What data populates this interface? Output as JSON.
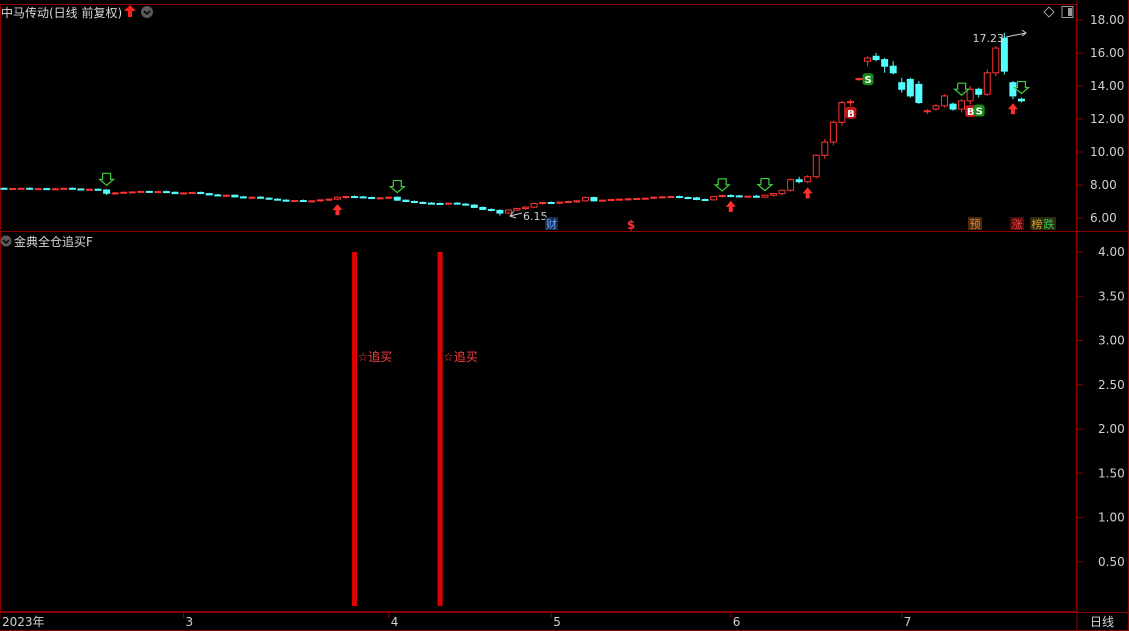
{
  "main_panel": {
    "title": "中马传动(日线 前复权)",
    "y_ticks": [
      "18.00",
      "16.00",
      "14.00",
      "12.00",
      "10.00",
      "8.00",
      "6.00"
    ],
    "high_label": "17.23",
    "low_label": "6.15",
    "badges": [
      {
        "text": "财",
        "color": "#6aa8ff"
      },
      {
        "text": "$",
        "color": "#ff3030"
      },
      {
        "text": "预",
        "color": "#e08030"
      },
      {
        "text": "涨",
        "color": "#ff4040"
      },
      {
        "text": "榜",
        "color": "#e0a020"
      },
      {
        "text": "跌",
        "color": "#30d050"
      }
    ]
  },
  "indicator_panel": {
    "title": "金典全仓追买F",
    "y_ticks": [
      "4.00",
      "3.50",
      "3.00",
      "2.50",
      "2.00",
      "1.50",
      "1.00",
      "0.50"
    ],
    "signal_label": "☆追买"
  },
  "x_axis": {
    "labels": [
      "2023年",
      "3",
      "4",
      "5",
      "6",
      "7"
    ],
    "period": "日线"
  },
  "colors": {
    "up": "#ff3232",
    "down": "#54ffff",
    "buy": "#ff3030",
    "sell": "#30c030",
    "grid": "#8b0000"
  },
  "chart_data": [
    {
      "type": "candlestick",
      "title": "中马传动(日线 前复权)",
      "ylim": [
        5.5,
        18.6
      ],
      "y_ticks": [
        18,
        16,
        14,
        12,
        10,
        8,
        6
      ],
      "x_ticks": [
        "2023年",
        "3",
        "4",
        "5",
        "6",
        "7"
      ],
      "annotations": [
        {
          "text": "17.23",
          "value": 17.23
        },
        {
          "text": "6.15",
          "value": 6.15
        }
      ],
      "ohlc": [
        [
          7.8,
          7.85,
          7.72,
          7.76
        ],
        [
          7.76,
          7.82,
          7.7,
          7.79
        ],
        [
          7.79,
          7.84,
          7.74,
          7.8
        ],
        [
          7.8,
          7.86,
          7.71,
          7.74
        ],
        [
          7.74,
          7.8,
          7.7,
          7.78
        ],
        [
          7.78,
          7.83,
          7.72,
          7.75
        ],
        [
          7.75,
          7.81,
          7.7,
          7.77
        ],
        [
          7.77,
          7.82,
          7.73,
          7.8
        ],
        [
          7.8,
          7.85,
          7.74,
          7.76
        ],
        [
          7.76,
          7.8,
          7.7,
          7.73
        ],
        [
          7.73,
          7.78,
          7.68,
          7.74
        ],
        [
          7.74,
          7.79,
          7.68,
          7.7
        ],
        [
          7.7,
          7.74,
          7.4,
          7.5
        ],
        [
          7.5,
          7.58,
          7.42,
          7.52
        ],
        [
          7.52,
          7.6,
          7.46,
          7.56
        ],
        [
          7.56,
          7.62,
          7.5,
          7.58
        ],
        [
          7.58,
          7.64,
          7.52,
          7.61
        ],
        [
          7.61,
          7.66,
          7.55,
          7.58
        ],
        [
          7.58,
          7.64,
          7.52,
          7.6
        ],
        [
          7.6,
          7.66,
          7.54,
          7.56
        ],
        [
          7.56,
          7.6,
          7.45,
          7.48
        ],
        [
          7.48,
          7.56,
          7.42,
          7.52
        ],
        [
          7.52,
          7.58,
          7.46,
          7.55
        ],
        [
          7.55,
          7.6,
          7.45,
          7.48
        ],
        [
          7.48,
          7.52,
          7.38,
          7.4
        ],
        [
          7.4,
          7.46,
          7.32,
          7.36
        ],
        [
          7.36,
          7.42,
          7.28,
          7.38
        ],
        [
          7.38,
          7.42,
          7.25,
          7.28
        ],
        [
          7.28,
          7.34,
          7.18,
          7.22
        ],
        [
          7.22,
          7.3,
          7.16,
          7.26
        ],
        [
          7.26,
          7.32,
          7.16,
          7.2
        ],
        [
          7.2,
          7.26,
          7.1,
          7.14
        ],
        [
          7.14,
          7.2,
          7.06,
          7.08
        ],
        [
          7.08,
          7.14,
          7.0,
          7.04
        ],
        [
          7.04,
          7.1,
          6.98,
          7.06
        ],
        [
          7.06,
          7.12,
          7.0,
          7.02
        ],
        [
          7.02,
          7.08,
          6.96,
          7.04
        ],
        [
          7.04,
          7.12,
          6.98,
          7.1
        ],
        [
          7.1,
          7.18,
          7.04,
          7.14
        ],
        [
          7.14,
          7.3,
          7.08,
          7.26
        ],
        [
          7.26,
          7.34,
          7.18,
          7.3
        ],
        [
          7.3,
          7.36,
          7.22,
          7.28
        ],
        [
          7.28,
          7.34,
          7.2,
          7.24
        ],
        [
          7.24,
          7.3,
          7.16,
          7.2
        ],
        [
          7.2,
          7.26,
          7.14,
          7.22
        ],
        [
          7.22,
          7.3,
          7.16,
          7.26
        ],
        [
          7.26,
          7.3,
          7.04,
          7.08
        ],
        [
          7.08,
          7.12,
          6.96,
          7.0
        ],
        [
          7.0,
          7.06,
          6.9,
          6.94
        ],
        [
          6.94,
          7.0,
          6.86,
          6.9
        ],
        [
          6.9,
          6.96,
          6.82,
          6.88
        ],
        [
          6.88,
          6.94,
          6.8,
          6.86
        ],
        [
          6.86,
          6.92,
          6.8,
          6.9
        ],
        [
          6.9,
          6.96,
          6.82,
          6.84
        ],
        [
          6.84,
          6.9,
          6.76,
          6.78
        ],
        [
          6.78,
          6.84,
          6.6,
          6.64
        ],
        [
          6.64,
          6.7,
          6.48,
          6.52
        ],
        [
          6.52,
          6.58,
          6.4,
          6.46
        ],
        [
          6.46,
          6.52,
          6.15,
          6.3
        ],
        [
          6.3,
          6.52,
          6.25,
          6.48
        ],
        [
          6.48,
          6.62,
          6.42,
          6.58
        ],
        [
          6.58,
          6.72,
          6.5,
          6.66
        ],
        [
          6.66,
          6.92,
          6.6,
          6.88
        ],
        [
          6.88,
          6.98,
          6.8,
          6.94
        ],
        [
          6.94,
          7.0,
          6.86,
          6.92
        ],
        [
          6.92,
          6.98,
          6.84,
          6.96
        ],
        [
          6.96,
          7.04,
          6.9,
          7.0
        ],
        [
          7.0,
          7.08,
          6.92,
          7.04
        ],
        [
          7.04,
          7.3,
          6.98,
          7.24
        ],
        [
          7.24,
          7.3,
          7.0,
          7.04
        ],
        [
          7.04,
          7.12,
          6.98,
          7.08
        ],
        [
          7.08,
          7.16,
          7.02,
          7.12
        ],
        [
          7.12,
          7.18,
          7.06,
          7.14
        ],
        [
          7.14,
          7.2,
          7.08,
          7.16
        ],
        [
          7.16,
          7.22,
          7.1,
          7.18
        ],
        [
          7.18,
          7.24,
          7.12,
          7.2
        ],
        [
          7.2,
          7.3,
          7.14,
          7.26
        ],
        [
          7.26,
          7.32,
          7.2,
          7.28
        ],
        [
          7.28,
          7.34,
          7.22,
          7.3
        ],
        [
          7.3,
          7.36,
          7.2,
          7.24
        ],
        [
          7.24,
          7.3,
          7.18,
          7.22
        ],
        [
          7.22,
          7.28,
          7.08,
          7.12
        ],
        [
          7.12,
          7.18,
          7.06,
          7.1
        ],
        [
          7.1,
          7.34,
          7.06,
          7.3
        ],
        [
          7.3,
          7.4,
          7.24,
          7.36
        ],
        [
          7.36,
          7.44,
          7.28,
          7.34
        ],
        [
          7.34,
          7.4,
          7.26,
          7.3
        ],
        [
          7.3,
          7.36,
          7.24,
          7.32
        ],
        [
          7.32,
          7.4,
          7.22,
          7.26
        ],
        [
          7.26,
          7.42,
          7.2,
          7.38
        ],
        [
          7.38,
          7.52,
          7.3,
          7.48
        ],
        [
          7.48,
          7.72,
          7.4,
          7.68
        ],
        [
          7.68,
          8.4,
          7.6,
          8.32
        ],
        [
          8.32,
          8.5,
          8.1,
          8.2
        ],
        [
          8.2,
          8.6,
          8.1,
          8.5
        ],
        [
          8.5,
          9.85,
          8.4,
          9.8
        ],
        [
          9.8,
          10.8,
          9.6,
          10.6
        ],
        [
          10.6,
          11.9,
          10.4,
          11.8
        ],
        [
          11.8,
          13.1,
          11.6,
          13.0
        ],
        [
          13.0,
          13.2,
          12.8,
          13.05
        ],
        [
          14.4,
          14.5,
          14.3,
          14.45
        ],
        [
          15.5,
          15.8,
          15.2,
          15.7
        ],
        [
          15.8,
          16.0,
          15.5,
          15.6
        ],
        [
          15.6,
          15.7,
          14.8,
          15.2
        ],
        [
          15.2,
          15.5,
          14.7,
          14.8
        ],
        [
          14.2,
          14.5,
          13.6,
          13.8
        ],
        [
          14.4,
          14.5,
          13.3,
          13.4
        ],
        [
          14.1,
          14.3,
          12.9,
          13.0
        ],
        [
          12.5,
          12.6,
          12.3,
          12.5
        ],
        [
          12.6,
          12.9,
          12.5,
          12.8
        ],
        [
          12.8,
          13.5,
          12.7,
          13.4
        ],
        [
          12.9,
          13.0,
          12.5,
          12.6
        ],
        [
          12.6,
          13.2,
          12.4,
          13.1
        ],
        [
          13.1,
          14.0,
          12.9,
          13.8
        ],
        [
          13.8,
          13.9,
          13.3,
          13.5
        ],
        [
          13.5,
          15.0,
          13.4,
          14.8
        ],
        [
          14.8,
          16.4,
          14.6,
          16.3
        ],
        [
          16.9,
          17.23,
          14.7,
          14.9
        ],
        [
          14.2,
          14.3,
          13.2,
          13.4
        ],
        [
          13.2,
          13.3,
          13.0,
          13.1
        ]
      ],
      "signals": [
        {
          "bar": 12,
          "kind": "sell-arrow"
        },
        {
          "bar": 39,
          "kind": "buy-arrow"
        },
        {
          "bar": 46,
          "kind": "sell-arrow"
        },
        {
          "bar": 84,
          "kind": "sell-arrow"
        },
        {
          "bar": 85,
          "kind": "buy-arrow"
        },
        {
          "bar": 89,
          "kind": "sell-arrow"
        },
        {
          "bar": 94,
          "kind": "buy-arrow"
        },
        {
          "bar": 99,
          "kind": "B"
        },
        {
          "bar": 101,
          "kind": "S"
        },
        {
          "bar": 112,
          "kind": "sell-arrow"
        },
        {
          "bar": 113,
          "kind": "B"
        },
        {
          "bar": 114,
          "kind": "S"
        },
        {
          "bar": 118,
          "kind": "buy-arrow"
        },
        {
          "bar": 119,
          "kind": "sell-arrow"
        }
      ]
    },
    {
      "type": "bar",
      "title": "金典全仓追买F",
      "ylim": [
        0,
        4.2
      ],
      "y_ticks": [
        4.0,
        3.5,
        3.0,
        2.5,
        2.0,
        1.5,
        1.0,
        0.5
      ],
      "series": [
        {
          "name": "☆追买",
          "points": [
            {
              "bar": 41,
              "value": 4.0
            },
            {
              "bar": 51,
              "value": 4.0
            }
          ]
        }
      ]
    }
  ]
}
